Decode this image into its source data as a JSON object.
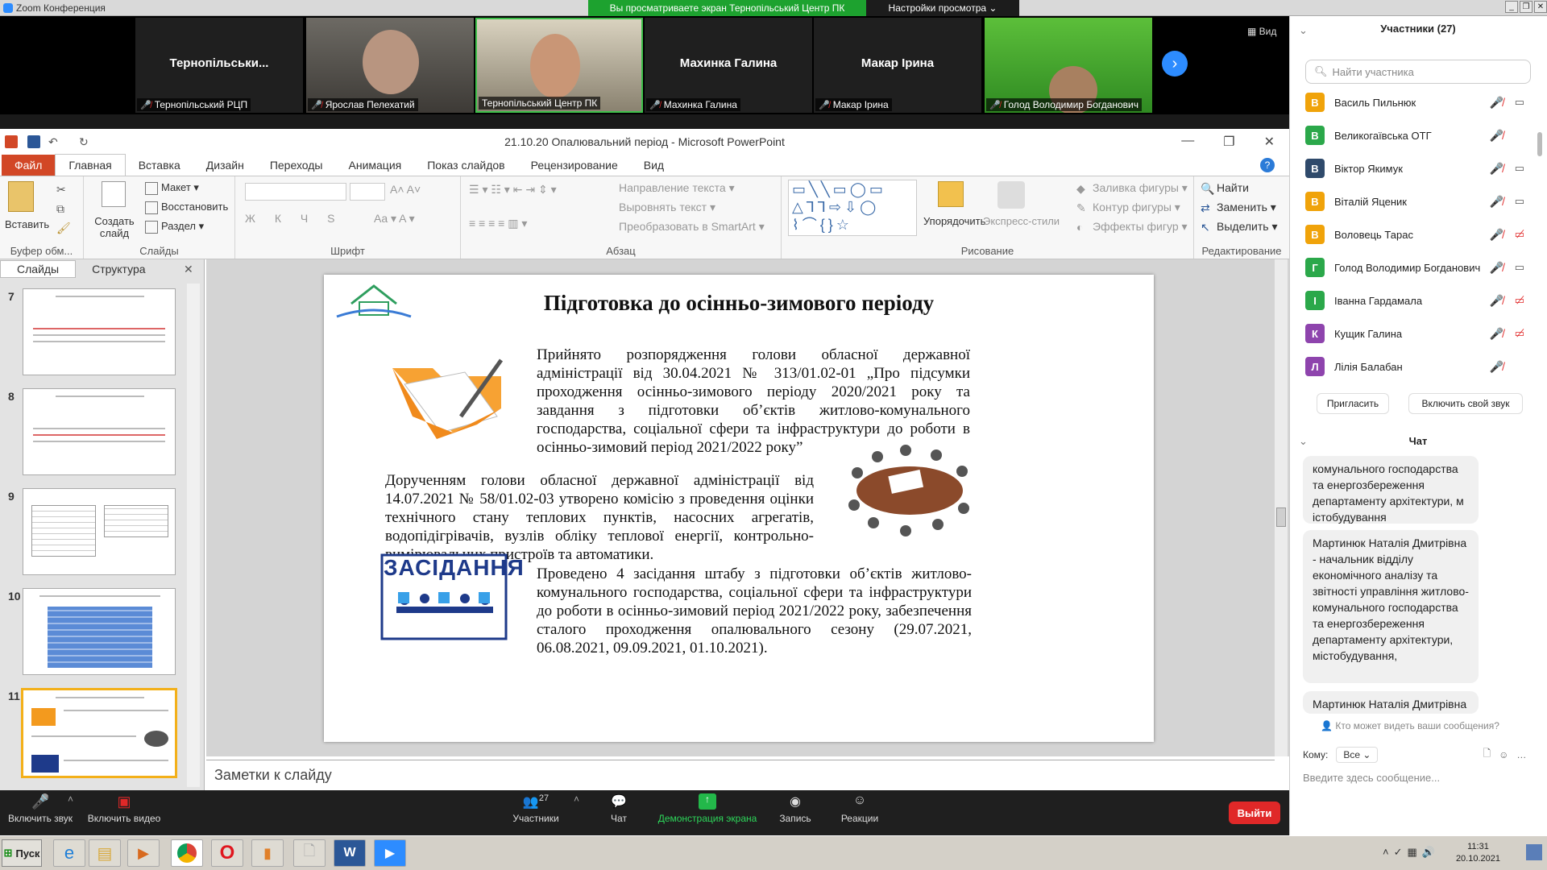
{
  "zoom": {
    "app_title": "Zoom Конференция",
    "share_banner": "Вы просматриваете экран Тернопільський Центр ПК",
    "view_settings": "Настройки просмотра",
    "view_button": "Вид"
  },
  "video_tiles": [
    {
      "big": "Тернопільськи...",
      "caption": "Тернопільський РЦП"
    },
    {
      "big": "",
      "caption": "Ярослав Пелехатий"
    },
    {
      "big": "",
      "caption": "Тернопільський Центр ПК"
    },
    {
      "big": "Махинка Галина",
      "caption": "Махинка Галина"
    },
    {
      "big": "Макар Ірина",
      "caption": "Макар Ірина"
    },
    {
      "big": "",
      "caption": "Голод Володимир Богданович"
    }
  ],
  "ppt": {
    "doc_title": "21.10.20 Опалювальний період - Microsoft PowerPoint",
    "tabs": [
      "Файл",
      "Главная",
      "Вставка",
      "Дизайн",
      "Переходы",
      "Анимация",
      "Показ слайдов",
      "Рецензирование",
      "Вид"
    ],
    "ribbon": {
      "paste": "Вставить",
      "clipboard_label": "Буфер обм...",
      "new_slide": "Создать слайд",
      "layout": "Макет",
      "reset": "Восстановить",
      "section": "Раздел",
      "slides_label": "Слайды",
      "font_label": "Шрифт",
      "paragraph_label": "Абзац",
      "text_direction": "Направление текста",
      "align_text": "Выровнять текст",
      "convert_smartart": "Преобразовать в SmartArt",
      "arrange": "Упорядочить",
      "quick_styles": "Экспресс-стили",
      "shape_fill": "Заливка фигуры",
      "shape_outline": "Контур фигуры",
      "shape_effects": "Эффекты фигур",
      "drawing_label": "Рисование",
      "find": "Найти",
      "replace": "Заменить",
      "select": "Выделить",
      "editing_label": "Редактирование"
    },
    "panel_tabs": [
      "Слайды",
      "Структура"
    ],
    "thumb_numbers": [
      "7",
      "8",
      "9",
      "10",
      "11"
    ],
    "notes_placeholder": "Заметки к слайду"
  },
  "slide": {
    "title": "Підготовка до осінньо-зимового періоду",
    "p1": "Прийнято розпорядження голови обласної державної адміністрації від 30.04.2021 № 313/01.02-01 „Про підсумки проходження осінньо-зимового періоду 2020/2021 року та завдання з підготовки об’єктів житлово-комунального господарства, соціальної сфери та інфраструктури до роботи в осінньо-зимовий період 2021/2022 року”",
    "p2": "Дорученням голови обласної державної адміністрації від 14.07.2021 № 58/01.02-03 утворено комісію з проведення оцінки технічного стану теплових пунктів, насосних агрегатів, водопідігрівачів, вузлів обліку теплової енергії, контрольно-вимірювальних пристроїв та автоматики.",
    "p3": "Проведено 4 засідання штабу з підготовки об’єктів житлово-комунального господарства, соціальної сфери та інфраструктури до роботи в осінньо-зимовий період 2021/2022 року, забезпечення сталого проходження опалювального сезону (29.07.2021, 06.08.2021, 09.09.2021, 01.10.2021).",
    "meeting_image_text": "ЗАСІДАННЯ"
  },
  "toolbar": {
    "unmute": "Включить звук",
    "start_video": "Включить видео",
    "participants": "Участники",
    "participants_count": "27",
    "chat": "Чат",
    "share": "Демонстрация экрана",
    "record": "Запись",
    "reactions": "Реакции",
    "leave": "Выйти"
  },
  "participants_panel": {
    "header": "Участники (27)",
    "search_placeholder": "Найти участника",
    "invite": "Пригласить",
    "unmute_me": "Включить свой звук",
    "list": [
      {
        "initial": "В",
        "name": "Василь Пильнюк",
        "color": "#f0a30a",
        "cam": "on"
      },
      {
        "initial": "В",
        "name": "Великогаївська ОТГ",
        "color": "#2ba84a",
        "cam": "none"
      },
      {
        "initial": "В",
        "name": "Віктор Якимук",
        "color": "#2f4a6b",
        "cam": "on"
      },
      {
        "initial": "В",
        "name": "Віталій Яценик",
        "color": "#f0a30a",
        "cam": "on"
      },
      {
        "initial": "В",
        "name": "Воловець Тарас",
        "color": "#f0a30a",
        "cam": "off"
      },
      {
        "initial": "Г",
        "name": "Голод Володимир Богданович",
        "color": "#2ba84a",
        "cam": "on"
      },
      {
        "initial": "І",
        "name": "Іванна Гардамала",
        "color": "#2ba84a",
        "cam": "off"
      },
      {
        "initial": "К",
        "name": "Кущик Галина",
        "color": "#8e44ad",
        "cam": "off"
      },
      {
        "initial": "Л",
        "name": "Лілія Балабан",
        "color": "#8e44ad",
        "cam": "none"
      }
    ]
  },
  "chat_panel": {
    "header": "Чат",
    "messages": [
      "комунального господарства та енергозбереження департаменту архітектури, м істобудування",
      "Мартинюк Наталія Дмитрівна - начальник відділу економічного аналізу та звітності управління житлово-комунального господарства та енергозбереження департаменту архітектури, містобудування,",
      "Мартинюк Наталія Дмитрівна"
    ],
    "visibility": "Кто может видеть ваши сообщения?",
    "to_label": "Кому:",
    "to_value": "Все",
    "input_placeholder": "Введите здесь сообщение..."
  },
  "taskbar": {
    "start": "Пуск",
    "time": "11:31",
    "date": "20.10.2021"
  }
}
